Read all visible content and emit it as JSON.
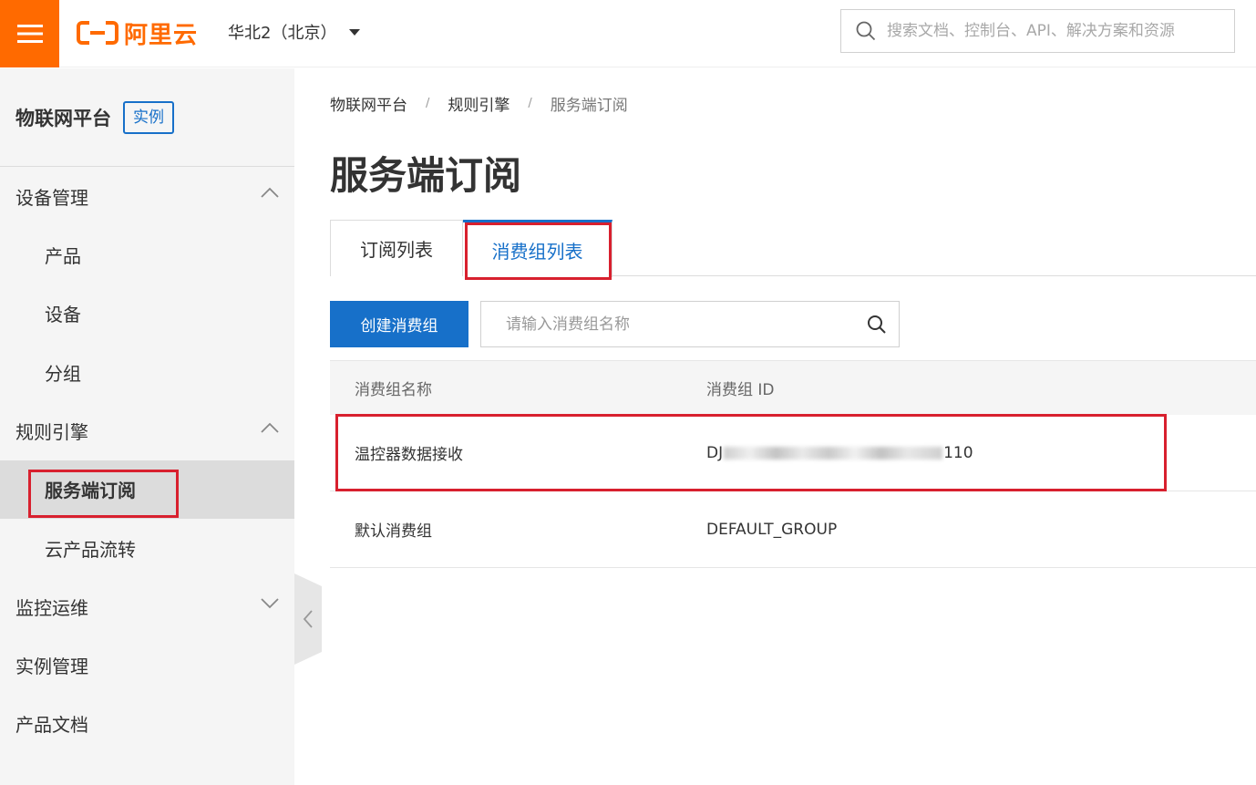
{
  "topbar": {
    "logo_text": "阿里云",
    "region": "华北2（北京）",
    "search_placeholder": "搜索文档、控制台、API、解决方案和资源"
  },
  "sidebar": {
    "title": "物联网平台",
    "badge": "实例",
    "groups": [
      {
        "label": "设备管理",
        "expanded": true,
        "items": [
          "产品",
          "设备",
          "分组"
        ]
      },
      {
        "label": "规则引擎",
        "expanded": true,
        "items": [
          "服务端订阅",
          "云产品流转"
        ]
      },
      {
        "label": "监控运维",
        "expanded": false
      },
      {
        "label": "实例管理"
      },
      {
        "label": "产品文档"
      }
    ],
    "active_item": "服务端订阅"
  },
  "breadcrumb": [
    "物联网平台",
    "规则引擎",
    "服务端订阅"
  ],
  "page_title": "服务端订阅",
  "tabs": [
    {
      "label": "订阅列表",
      "active": false
    },
    {
      "label": "消费组列表",
      "active": true
    }
  ],
  "toolbar": {
    "create_label": "创建消费组",
    "search_placeholder": "请输入消费组名称"
  },
  "table": {
    "columns": [
      "消费组名称",
      "消费组 ID"
    ],
    "rows": [
      {
        "name": "温控器数据接收",
        "id_prefix": "DJ",
        "id_suffix": "110"
      },
      {
        "name": "默认消费组",
        "id": "DEFAULT_GROUP"
      }
    ]
  },
  "colors": {
    "brand_orange": "#ff6a00",
    "primary_blue": "#1770c9",
    "highlight_red": "#d8202e"
  }
}
